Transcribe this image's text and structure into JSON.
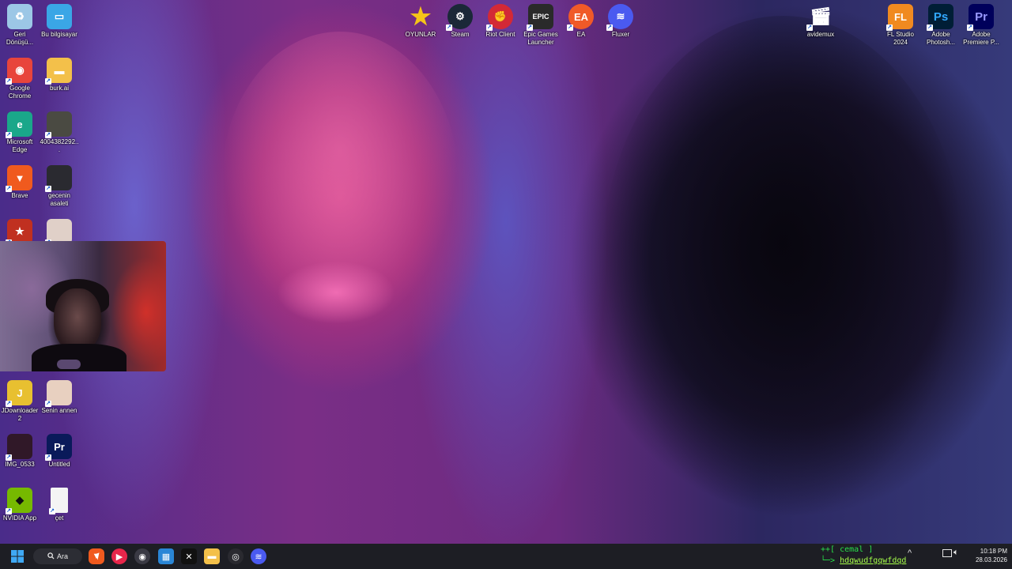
{
  "desktop": {
    "left_icons": [
      {
        "label": "Geri Dönüşü...",
        "icon": "recycle-bin-icon",
        "color": "#9cc7e6"
      },
      {
        "label": "Bu bilgisayar",
        "icon": "monitor-icon",
        "color": "#3aa6e6"
      },
      {
        "label": "Google Chrome",
        "icon": "chrome-icon",
        "color": "#e8453c"
      },
      {
        "label": "burk.ai",
        "icon": "folder-icon",
        "color": "#f3c04a"
      },
      {
        "label": "Microsoft Edge",
        "icon": "edge-icon",
        "color": "#1aa78a"
      },
      {
        "label": "4004382292...",
        "icon": "image-thumbnail-icon",
        "color": "#4a4a42"
      },
      {
        "label": "Brave",
        "icon": "brave-icon",
        "color": "#f05a1e"
      },
      {
        "label": "gecenin asaleti",
        "icon": "image-thumbnail-icon",
        "color": "#2a2a30"
      },
      {
        "label": "",
        "icon": "game-icon",
        "color": "#c03020"
      },
      {
        "label": "",
        "icon": "portrait-icon",
        "color": "#e0d0c8"
      },
      {
        "label": "JDownloader 2",
        "icon": "jdownloader-icon",
        "color": "#e8c030"
      },
      {
        "label": "Senin annen",
        "icon": "anime-thumbnail-icon",
        "color": "#e8d0c0"
      },
      {
        "label": "IMG_0533",
        "icon": "image-thumbnail-icon",
        "color": "#301828"
      },
      {
        "label": "Untitled",
        "icon": "premiere-project-icon",
        "color": "#0a1a5a"
      },
      {
        "label": "NVIDIA App",
        "icon": "nvidia-icon",
        "color": "#76b900"
      },
      {
        "label": "çet",
        "icon": "text-file-icon",
        "color": "#f4f4f4"
      }
    ],
    "top_icons": [
      {
        "label": "OYUNLAR",
        "icon": "star-icon",
        "color": "#f5c518"
      },
      {
        "label": "Steam",
        "icon": "steam-icon",
        "color": "#1b2838"
      },
      {
        "label": "Riot Client",
        "icon": "riot-icon",
        "color": "#d32936"
      },
      {
        "label": "Epic Games Launcher",
        "icon": "epic-games-icon",
        "color": "#2a2a2a"
      },
      {
        "label": "EA",
        "icon": "ea-icon",
        "color": "#f05a28"
      },
      {
        "label": "Fluxer",
        "icon": "fluxer-icon",
        "color": "#4a5af0"
      },
      {
        "label": "avidemux",
        "icon": "clapperboard-icon",
        "color": "#333333"
      },
      {
        "label": "FL Studio 2024",
        "icon": "fl-studio-icon",
        "color": "#f08a20"
      },
      {
        "label": "Adobe Photosh...",
        "icon": "photoshop-icon",
        "color": "#001e36"
      },
      {
        "label": "Adobe Premiere P...",
        "icon": "premiere-icon",
        "color": "#00005b"
      }
    ]
  },
  "taskbar": {
    "search_label": "Ara",
    "terminal_line1": "++[ cemal ]",
    "terminal_line2_prefix": "└─>",
    "terminal_line2_text": "hdqwudfgqwfdqd",
    "time": "10:18 PM",
    "date": "28.03.2026",
    "tray_chevron": "^"
  }
}
